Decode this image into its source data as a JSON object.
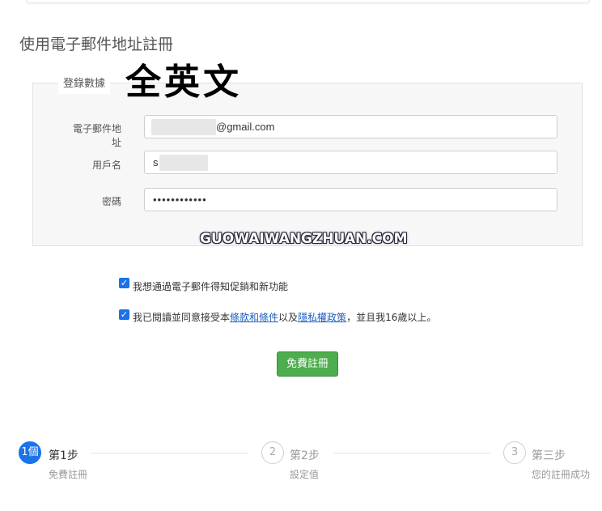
{
  "page_title": "使用電子郵件地址註冊",
  "section": {
    "legend": "登錄數據",
    "overlay_text": "全英文"
  },
  "fields": {
    "email": {
      "label": "電子郵件地址",
      "value": "@gmail.com"
    },
    "username": {
      "label": "用戶名",
      "value": "s"
    },
    "password": {
      "label": "密碼",
      "value": "••••••••••••"
    }
  },
  "watermark": "GUOWAIWANGZHUAN.COM",
  "checkboxes": {
    "promo": {
      "checked": true,
      "label": "我想通過電子郵件得知促銷和新功能"
    },
    "terms": {
      "checked": true,
      "prefix": "我已閱讀並同意接受本",
      "link1": "條款和條件",
      "middle": "以及",
      "link2": "隱私權政策",
      "suffix": "，並且我16歲以上。"
    }
  },
  "submit_button": "免費註冊",
  "steps": [
    {
      "number": "1個",
      "title": "第1步",
      "subtitle": "免費註冊",
      "active": true
    },
    {
      "number": "2",
      "title": "第2步",
      "subtitle": "設定值",
      "active": false
    },
    {
      "number": "3",
      "title": "第三步",
      "subtitle": "您的註冊成功",
      "active": false
    }
  ],
  "colors": {
    "accent": "#1a73e8",
    "button": "#4cae4c",
    "link": "#1f5fbf"
  }
}
